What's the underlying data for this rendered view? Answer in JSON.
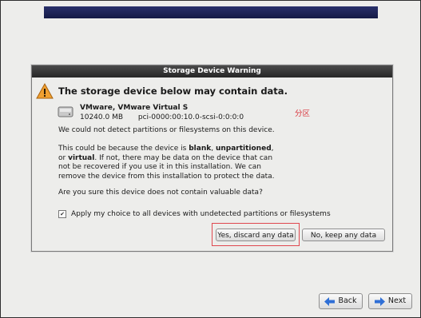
{
  "dialog": {
    "title": "Storage Device Warning",
    "headline": "The storage device below may contain data.",
    "device": {
      "name": "VMware, VMware Virtual S",
      "size": "10240.0 MB",
      "path": "pci-0000:00:10.0-scsi-0:0:0:0"
    },
    "annotation": "分区",
    "paragraph1": "We could not detect partitions or filesystems on this device.",
    "paragraph2": {
      "line1_pre": "This could be because the device is ",
      "blank": "blank",
      "sep1": ", ",
      "unpartitioned": "unpartitioned",
      "sep2": ",",
      "line2_pre": "or ",
      "virtual": "virtual",
      "line2_post": ". If not, there may be data on the device that can",
      "line3": "not be recovered if you use it in this installation. We can",
      "line4": "remove the device from this installation to protect the data."
    },
    "paragraph3": "Are you sure this device does not contain valuable data?",
    "checkbox": {
      "label": "Apply my choice to all devices with undetected partitions or filesystems",
      "checked": true
    },
    "buttons": {
      "yes": "Yes, discard any data",
      "no": "No, keep any data"
    }
  },
  "nav": {
    "back": "Back",
    "next": "Next"
  },
  "colors": {
    "banner": "#1c2255",
    "dialog_title_bar": "#333333",
    "annotation": "#d9363e",
    "warning_icon": "#f0a030"
  }
}
